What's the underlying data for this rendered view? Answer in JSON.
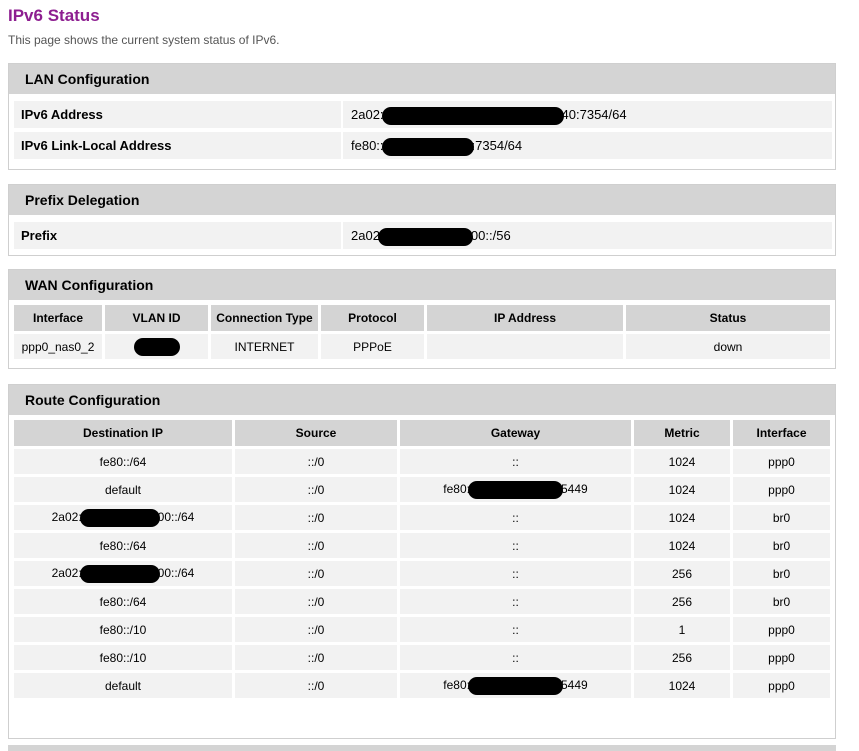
{
  "page": {
    "title": "IPv6 Status",
    "description": "This page shows the current system status of IPv6."
  },
  "lan": {
    "header": "LAN Configuration",
    "rows": [
      {
        "label": "IPv6 Address",
        "prefix": "2a02:",
        "suffix": "40:7354/64"
      },
      {
        "label": "IPv6 Link-Local Address",
        "prefix": "fe80::",
        "suffix": ":7354/64"
      }
    ]
  },
  "prefix_delegation": {
    "header": "Prefix Delegation",
    "rows": [
      {
        "label": "Prefix",
        "prefix": "2a02",
        "suffix": "00::/56"
      }
    ]
  },
  "wan": {
    "header": "WAN Configuration",
    "columns": [
      "Interface",
      "VLAN ID",
      "Connection Type",
      "Protocol",
      "IP Address",
      "Status"
    ],
    "row": {
      "interface": "ppp0_nas0_2",
      "connection_type": "INTERNET",
      "protocol": "PPPoE",
      "ip_address": "",
      "status": "down"
    }
  },
  "route": {
    "header": "Route Configuration",
    "columns": [
      "Destination IP",
      "Source",
      "Gateway",
      "Metric",
      "Interface"
    ],
    "rows": [
      {
        "dest": "fe80::/64",
        "source": "::/0",
        "gateway": "::",
        "metric": "1024",
        "iface": "ppp0"
      },
      {
        "dest": "default",
        "source": "::/0",
        "gw_prefix": "fe80:",
        "gw_suffix": "5449",
        "metric": "1024",
        "iface": "ppp0"
      },
      {
        "dest_prefix": "2a02:",
        "dest_suffix": "00::/64",
        "source": "::/0",
        "gateway": "::",
        "metric": "1024",
        "iface": "br0"
      },
      {
        "dest": "fe80::/64",
        "source": "::/0",
        "gateway": "::",
        "metric": "1024",
        "iface": "br0"
      },
      {
        "dest_prefix": "2a02:",
        "dest_suffix": "00::/64",
        "source": "::/0",
        "gateway": "::",
        "metric": "256",
        "iface": "br0"
      },
      {
        "dest": "fe80::/64",
        "source": "::/0",
        "gateway": "::",
        "metric": "256",
        "iface": "br0"
      },
      {
        "dest": "fe80::/10",
        "source": "::/0",
        "gateway": "::",
        "metric": "1",
        "iface": "ppp0"
      },
      {
        "dest": "fe80::/10",
        "source": "::/0",
        "gateway": "::",
        "metric": "256",
        "iface": "ppp0"
      },
      {
        "dest": "default",
        "source": "::/0",
        "gw_prefix": "fe80:",
        "gw_suffix": "5449",
        "metric": "1024",
        "iface": "ppp0"
      }
    ]
  }
}
